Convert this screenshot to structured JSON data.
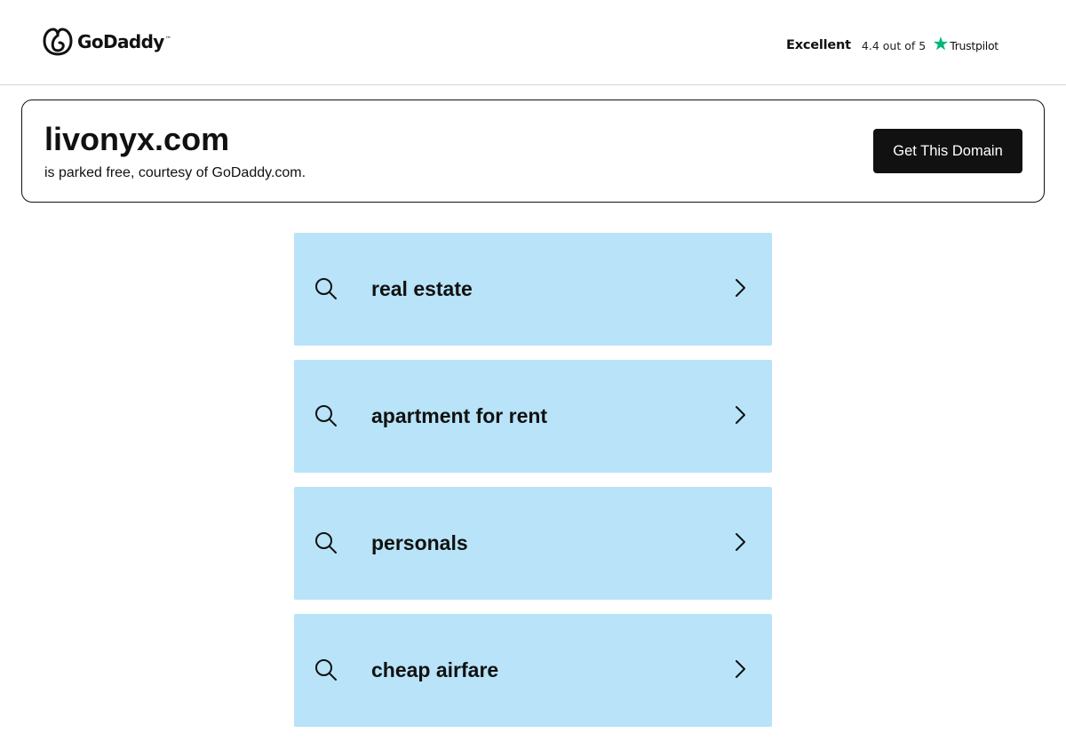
{
  "header": {
    "logo": {
      "text": "GoDaddy",
      "tm": "™",
      "icon": "godaddy-logo-icon"
    },
    "trustpilot": {
      "rating_word": "Excellent",
      "score_text": "4.4 out of 5",
      "brand": "Trustpilot",
      "icon": "trustpilot-star-icon",
      "star_color": "#00b67a"
    }
  },
  "domain_card": {
    "domain": "livonyx.com",
    "subtitle": "is parked free, courtesy of GoDaddy.com.",
    "cta_label": "Get This Domain"
  },
  "results": [
    {
      "label": "real estate"
    },
    {
      "label": "apartment for rent"
    },
    {
      "label": "personals"
    },
    {
      "label": "cheap airfare"
    }
  ],
  "icons": {
    "search": "search-icon",
    "chevron": "chevron-right-icon"
  },
  "colors": {
    "result_background": "#b8e3f8",
    "cta_background": "#111111",
    "cta_text": "#ffffff",
    "card_border": "#111111",
    "header_divider": "#d6d6d6"
  }
}
